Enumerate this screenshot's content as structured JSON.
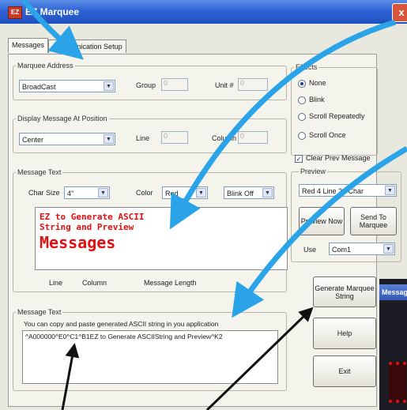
{
  "window": {
    "title": "EZ Marquee",
    "icon": "EZ",
    "close": "x"
  },
  "tabs": [
    "Messages",
    "Communication Setup"
  ],
  "marquee_address": {
    "title": "Marquee Address",
    "address_value": "BroadCast",
    "group_label": "Group",
    "group_value": "0",
    "unit_label": "Unit #",
    "unit_value": "0"
  },
  "display_position": {
    "title": "Display Message At Position",
    "position_value": "Center",
    "line_label": "Line",
    "line_value": "0",
    "column_label": "Column",
    "column_value": "0"
  },
  "message_text": {
    "title": "Message Text",
    "char_size_label": "Char Size",
    "char_size_value": "4\"",
    "color_label": "Color",
    "color_value": "Red",
    "blink_value": "Blink Off",
    "preview_line1": "EZ to Generate ASCII",
    "preview_line2": "String and Preview",
    "preview_line3": "Messages",
    "status_line": "Line",
    "status_column": "Column",
    "status_length": "Message Length"
  },
  "ascii_output": {
    "title": "Message Text",
    "hint": "You can copy and paste generated ASCII string in you application",
    "value": "^A000000^E0^C1^B1EZ to Generate ASCIIString and Preview^K2"
  },
  "effects": {
    "title": "Effects",
    "options": [
      "None",
      "Blink",
      "Scroll Repeatedly",
      "Scroll Once"
    ],
    "selected": "None"
  },
  "clear_prev": {
    "label": "Clear Prev Message",
    "checked": true
  },
  "preview": {
    "title": "Preview",
    "device_value": "Red 4 Line 20 Char",
    "preview_now": "Preview Now",
    "send_to": "Send To Marquee",
    "use_label": "Use",
    "port_value": "Com1"
  },
  "buttons": {
    "generate": "Generate Marquee String",
    "help": "Help",
    "exit": "Exit"
  },
  "side_window": {
    "title": "Messag"
  },
  "icons": {
    "dropdown": "chevron-down-icon",
    "annotation": "arrow-icon"
  },
  "colors": {
    "titlebar": "#2f64d6",
    "led_text": "#e01010",
    "arrow": "#2aa3e8",
    "arrow_dark": "#111111"
  }
}
